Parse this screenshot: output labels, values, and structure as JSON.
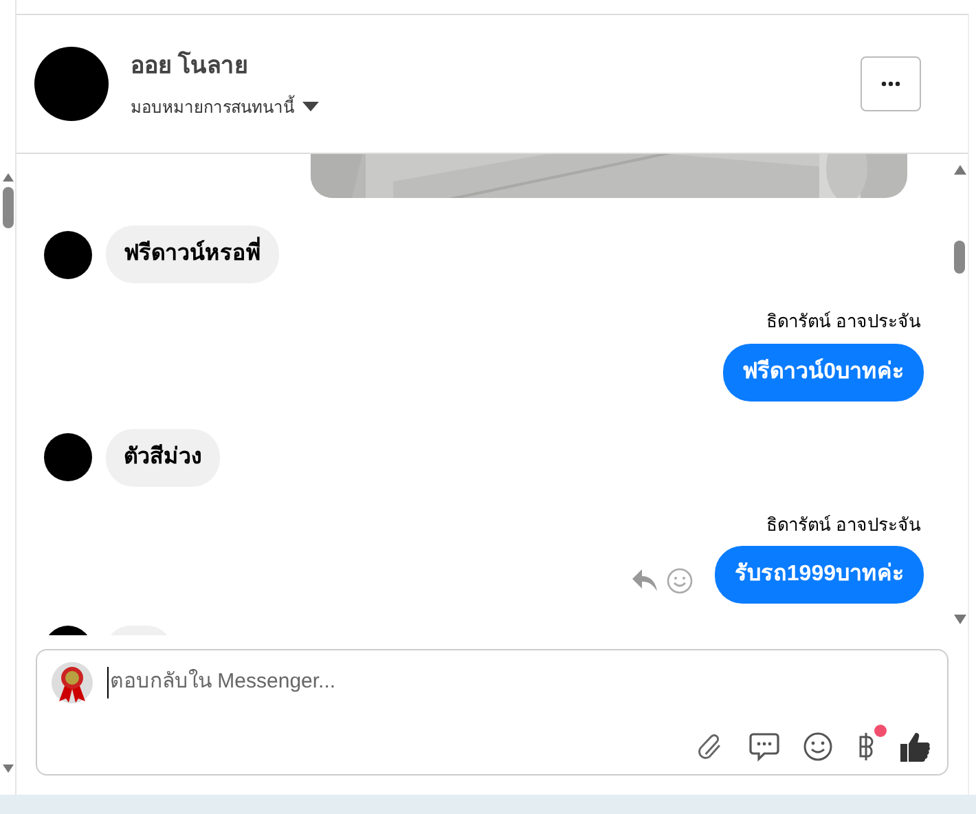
{
  "header": {
    "name": "ออย โนลาย",
    "subtitle": "มอบหมายการสนทนานี้"
  },
  "messages": [
    {
      "kind": "picture"
    },
    {
      "kind": "incoming",
      "text": "ฟรีดาวน์หรอพี่"
    },
    {
      "kind": "outgoing",
      "sender": "ธิดารัตน์ อาจประจัน",
      "text": "ฟรีดาวน์0บาทค่ะ",
      "actions": false
    },
    {
      "kind": "incoming",
      "text": "ตัวสีม่วง"
    },
    {
      "kind": "outgoing",
      "sender": "ธิดารัตน์ อาจประจัน",
      "text": "รับรถ1999บาทค่ะ",
      "actions": true
    },
    {
      "kind": "cut"
    }
  ],
  "composer": {
    "placeholder": "ตอบกลับใน Messenger...",
    "payment_badge": true
  }
}
